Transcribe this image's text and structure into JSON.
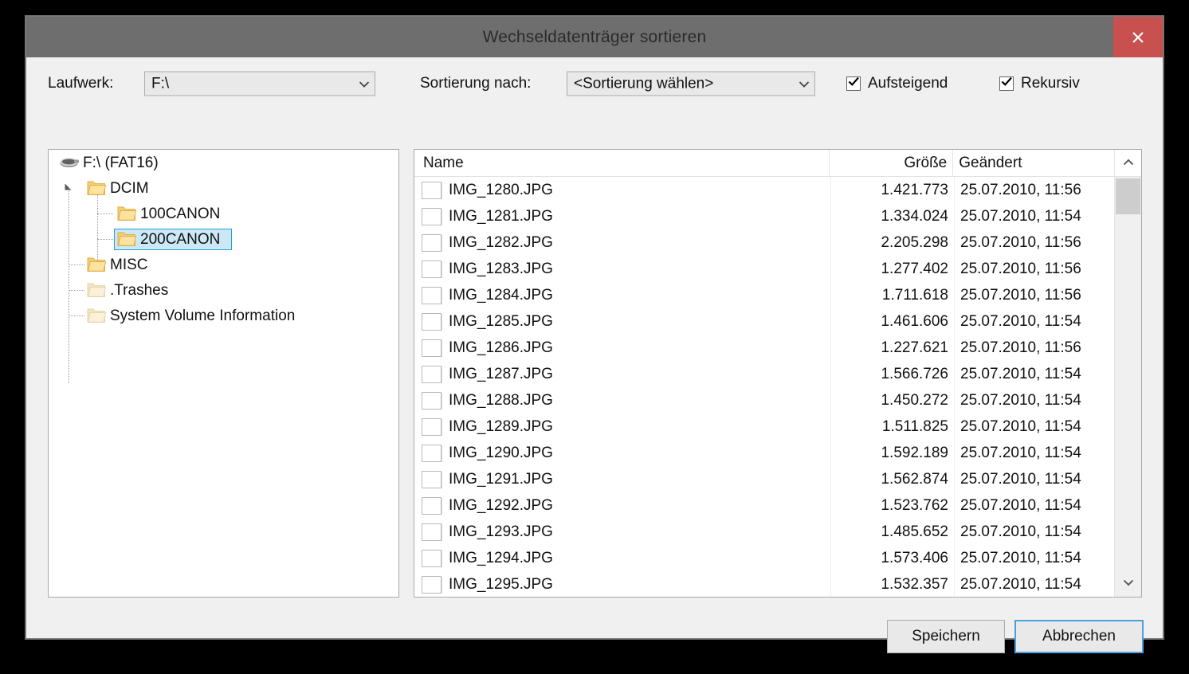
{
  "window": {
    "title": "Wechseldatenträger sortieren",
    "close_icon": "close-icon",
    "close_color": "#c8504f",
    "titlebar_color": "#6e6e6e"
  },
  "toolbar": {
    "drive_label": "Laufwerk:",
    "drive_value": "F:\\",
    "sort_label": "Sortierung nach:",
    "sort_value": "<Sortierung wählen>",
    "ascending_label": "Aufsteigend",
    "ascending_checked": true,
    "recursive_label": "Rekursiv",
    "recursive_checked": true,
    "caret_icon": "chevron-down-icon",
    "check_icon": "checkmark-icon"
  },
  "tree": {
    "selection_fill": "#cce8f7",
    "selection_border": "#26a0da",
    "nodes": [
      {
        "label": "F:\\ (FAT16)",
        "icon": "removable-drive-icon",
        "depth": 0,
        "selected": false,
        "expander": "none",
        "dim": false
      },
      {
        "label": "DCIM",
        "icon": "folder-icon",
        "depth": 1,
        "selected": false,
        "expander": "expanded",
        "dim": false
      },
      {
        "label": "100CANON",
        "icon": "folder-icon",
        "depth": 2,
        "selected": false,
        "expander": "none",
        "dim": false
      },
      {
        "label": "200CANON",
        "icon": "folder-icon",
        "depth": 2,
        "selected": true,
        "expander": "none",
        "dim": false
      },
      {
        "label": "MISC",
        "icon": "folder-icon",
        "depth": 1,
        "selected": false,
        "expander": "none",
        "dim": false
      },
      {
        "label": ".Trashes",
        "icon": "folder-hidden-icon",
        "depth": 1,
        "selected": false,
        "expander": "none",
        "dim": true
      },
      {
        "label": "System Volume Information",
        "icon": "folder-hidden-icon",
        "depth": 1,
        "selected": false,
        "expander": "none",
        "dim": true
      }
    ]
  },
  "filelist": {
    "columns": [
      "Name",
      "Größe",
      "Geändert"
    ],
    "scroll_up_icon": "chevron-up-icon",
    "scroll_down_icon": "chevron-down-icon",
    "rows": [
      {
        "name": "IMG_1280.JPG",
        "size": "1.421.773",
        "modified": "25.07.2010, 11:56",
        "icon": "image-thumbnail-icon"
      },
      {
        "name": "IMG_1281.JPG",
        "size": "1.334.024",
        "modified": "25.07.2010, 11:54",
        "icon": "image-thumbnail-icon"
      },
      {
        "name": "IMG_1282.JPG",
        "size": "2.205.298",
        "modified": "25.07.2010, 11:56",
        "icon": "image-thumbnail-icon"
      },
      {
        "name": "IMG_1283.JPG",
        "size": "1.277.402",
        "modified": "25.07.2010, 11:56",
        "icon": "image-thumbnail-icon"
      },
      {
        "name": "IMG_1284.JPG",
        "size": "1.711.618",
        "modified": "25.07.2010, 11:56",
        "icon": "image-thumbnail-icon"
      },
      {
        "name": "IMG_1285.JPG",
        "size": "1.461.606",
        "modified": "25.07.2010, 11:54",
        "icon": "image-thumbnail-icon"
      },
      {
        "name": "IMG_1286.JPG",
        "size": "1.227.621",
        "modified": "25.07.2010, 11:56",
        "icon": "image-thumbnail-icon"
      },
      {
        "name": "IMG_1287.JPG",
        "size": "1.566.726",
        "modified": "25.07.2010, 11:54",
        "icon": "image-thumbnail-icon"
      },
      {
        "name": "IMG_1288.JPG",
        "size": "1.450.272",
        "modified": "25.07.2010, 11:54",
        "icon": "image-thumbnail-icon"
      },
      {
        "name": "IMG_1289.JPG",
        "size": "1.511.825",
        "modified": "25.07.2010, 11:54",
        "icon": "image-thumbnail-icon"
      },
      {
        "name": "IMG_1290.JPG",
        "size": "1.592.189",
        "modified": "25.07.2010, 11:54",
        "icon": "image-thumbnail-icon"
      },
      {
        "name": "IMG_1291.JPG",
        "size": "1.562.874",
        "modified": "25.07.2010, 11:54",
        "icon": "image-thumbnail-icon"
      },
      {
        "name": "IMG_1292.JPG",
        "size": "1.523.762",
        "modified": "25.07.2010, 11:54",
        "icon": "image-thumbnail-icon"
      },
      {
        "name": "IMG_1293.JPG",
        "size": "1.485.652",
        "modified": "25.07.2010, 11:54",
        "icon": "image-thumbnail-icon"
      },
      {
        "name": "IMG_1294.JPG",
        "size": "1.573.406",
        "modified": "25.07.2010, 11:54",
        "icon": "image-thumbnail-icon"
      },
      {
        "name": "IMG_1295.JPG",
        "size": "1.532.357",
        "modified": "25.07.2010, 11:54",
        "icon": "image-thumbnail-icon"
      }
    ]
  },
  "footer": {
    "save_label": "Speichern",
    "cancel_label": "Abbrechen",
    "focus_color": "#4ba0dd"
  }
}
